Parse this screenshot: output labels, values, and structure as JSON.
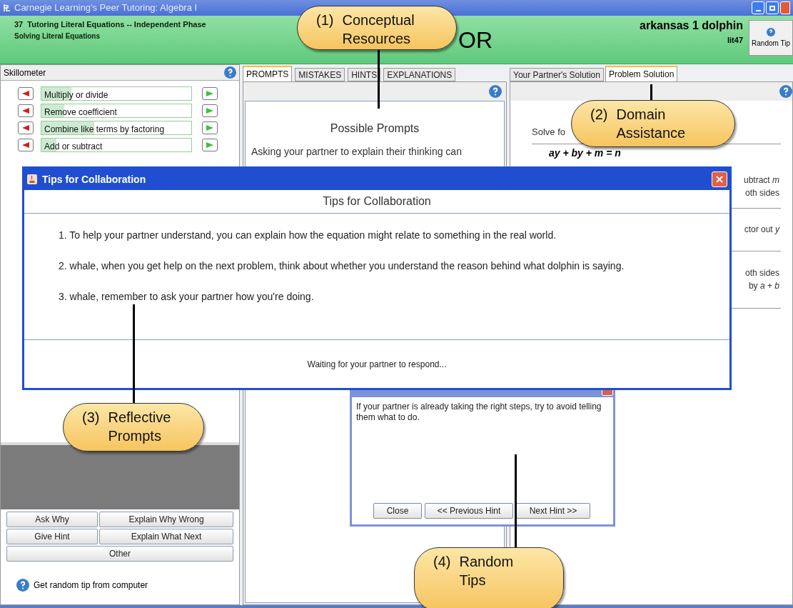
{
  "window": {
    "title": "Carnegie Learning's Peer Tutoring: Algebra I"
  },
  "header": {
    "lesson": "37  Tutoring Literal Equations -- Independent Phase",
    "section": "Solving Literal Equations",
    "banner_fragment": "OR",
    "user": "arkansas 1 dolphin",
    "user_id": "lit47",
    "random_tip_button": "Random Tip"
  },
  "skillometer": {
    "title": "Skillometer",
    "skills": [
      {
        "name": "Multiply or divide",
        "level": 0.2
      },
      {
        "name": "Remove coefficient",
        "level": 0.15
      },
      {
        "name": "Combine like terms by factoring",
        "level": 0.35
      },
      {
        "name": "Add or subtract",
        "level": 0.1
      }
    ]
  },
  "middle_panel": {
    "tabs": [
      {
        "label": "PROMPTS",
        "selected": true
      },
      {
        "label": "MISTAKES",
        "selected": false
      },
      {
        "label": "HINTS",
        "selected": false
      },
      {
        "label": "EXPLANATIONS",
        "selected": false
      }
    ],
    "heading": "Possible Prompts",
    "text": "Asking your partner to explain their thinking can"
  },
  "right_panel": {
    "tabs": [
      {
        "label": "Your Partner's Solution",
        "selected": false
      },
      {
        "label": "Problem Solution",
        "selected": true
      }
    ],
    "instruction": "Solve fo",
    "equation": "ay + by + m = n",
    "steps": [
      [
        "ubtract *m*",
        "oth sides"
      ],
      [
        "ctor out *y*"
      ],
      [
        "oth sides",
        "by *a* + *b*"
      ]
    ]
  },
  "actions": {
    "buttons": [
      [
        "Ask Why",
        "Explain Why Wrong"
      ],
      [
        "Give Hint",
        "Explain What Next"
      ],
      [
        "Other"
      ]
    ],
    "tip_link": "Get random tip from computer"
  },
  "tips_dialog": {
    "title": "Tips for Collaboration",
    "heading": "Tips for Collaboration",
    "tips": [
      "1. To help your partner understand, you can explain how the equation might relate to something in the real world.",
      "2. whale, when you get help on the next problem, think about whether you understand the reason behind what dolphin is saying.",
      "3. whale, remember to ask your partner how you're doing."
    ],
    "status": "Waiting for your partner to respond..."
  },
  "hint_window": {
    "text": "If your partner is already taking the right steps, try to avoid telling them what to do.",
    "buttons": [
      "Close",
      "<< Previous Hint",
      "Next Hint >>"
    ]
  },
  "callouts": [
    {
      "number": "(1)",
      "lines": [
        "Conceptual",
        "Resources"
      ]
    },
    {
      "number": "(2)",
      "lines": [
        "Domain",
        "Assistance"
      ]
    },
    {
      "number": "(3)",
      "lines": [
        "Reflective",
        "Prompts"
      ]
    },
    {
      "number": "(4)",
      "lines": [
        "Random",
        "Tips"
      ]
    }
  ]
}
